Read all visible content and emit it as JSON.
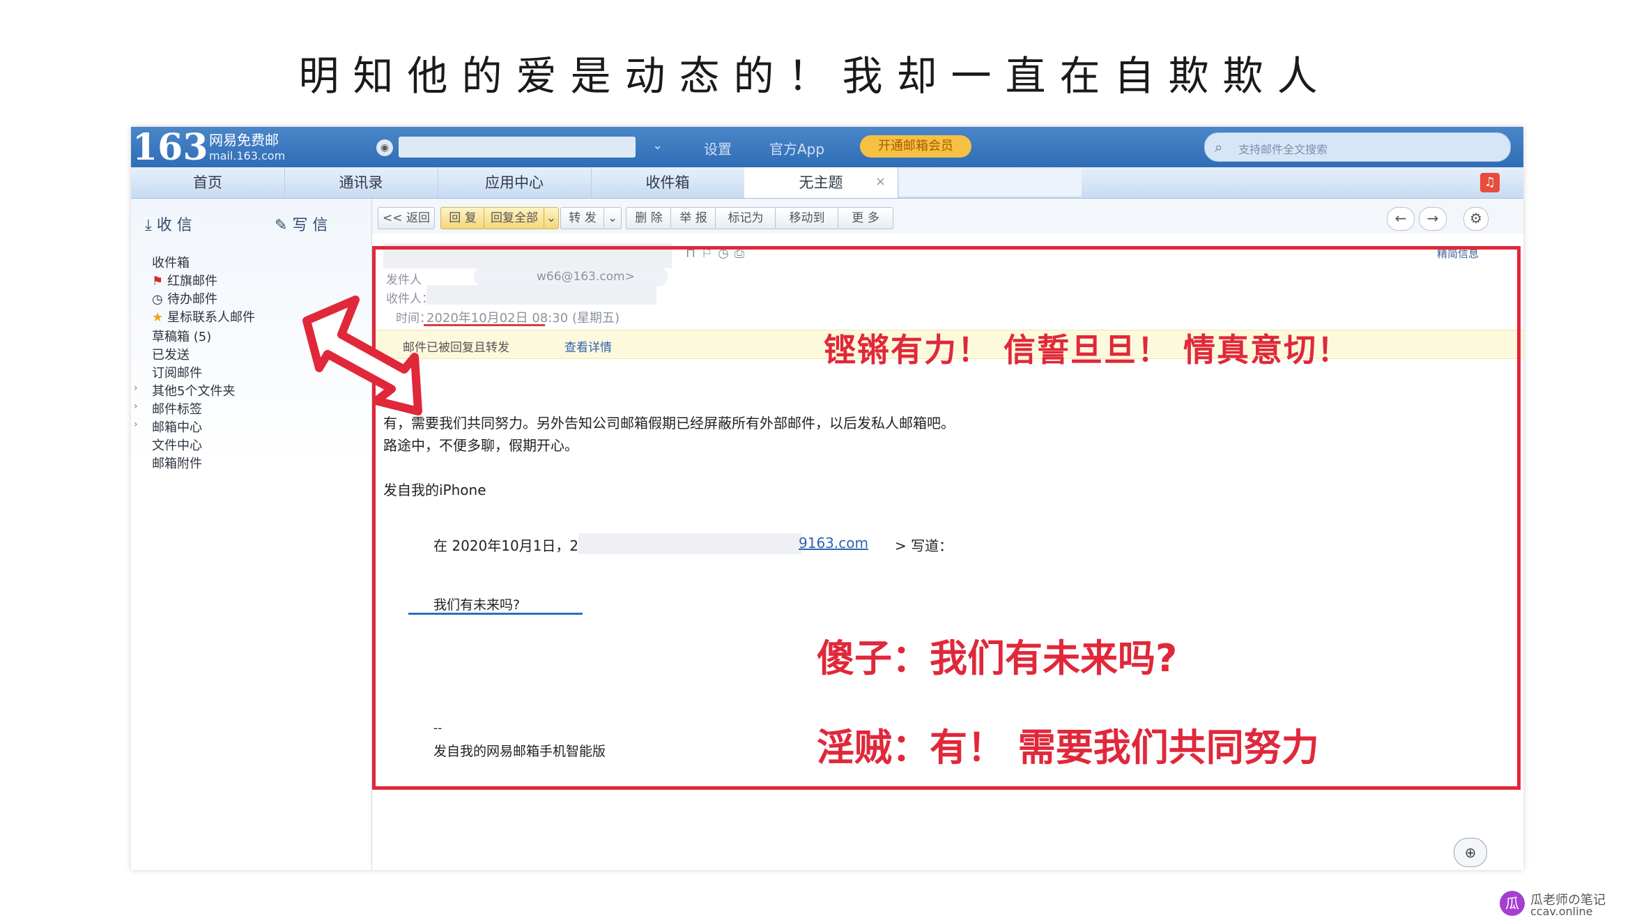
{
  "headline": "明知他的爱是动态的！我却一直在自欺欺人",
  "topbar": {
    "logo": "163",
    "logo_sub": "网易免费邮",
    "logo_url": "mail.163.com",
    "settings": "设置",
    "app": "官方App",
    "vip": "开通邮箱会员",
    "search_placeholder": "支持邮件全文搜索"
  },
  "tabs": [
    "首页",
    "通讯录",
    "应用中心",
    "收件箱",
    "无主题"
  ],
  "sidebar": {
    "receive": "收 信",
    "write": "写 信",
    "items": [
      "收件箱",
      "红旗邮件",
      "待办邮件",
      "星标联系人邮件",
      "草稿箱 (5)",
      "已发送",
      "订阅邮件",
      "其他5个文件夹",
      "邮件标签",
      "邮箱中心",
      "文件中心",
      "邮箱附件"
    ]
  },
  "toolbar": {
    "back": "<< 返回",
    "reply": "回 复",
    "reply_all": "回复全部",
    "forward": "转 发",
    "delete": "删 除",
    "report": "举 报",
    "mark": "标记为",
    "move": "移动到",
    "more": "更 多"
  },
  "mail": {
    "summary": "精简信息",
    "from_label": "发件人",
    "from_addr": "w66@163.com>",
    "to_label": "收件人：",
    "time_label": "时间：",
    "date": "2020年10月02日 08:30",
    "weekday": "(星期五)",
    "notice": "邮件已被回复且转发",
    "notice_link": "查看详情",
    "body_line1": "有，需要我们共同努力。另外告知公司邮箱假期已经屏蔽所有外部邮件，以后发私人邮箱吧。",
    "body_line2": "路途中，不便多聊，假期开心。",
    "body_sig": "发自我的iPhone",
    "quote_prefix": "在 2020年10月1日，21:02,",
    "quote_addr": "9163.com",
    "quote_wrote": "> 写道：",
    "quote_text": "我们有未来吗?",
    "quote_dash": "--",
    "quote_sig": "发自我的网易邮箱手机智能版"
  },
  "annotations": {
    "a1": "铿锵有力！ 信誓旦旦！ 情真意切！",
    "a2": "傻子：我们有未来吗?",
    "a3": "淫贼：有！ 需要我们共同努力"
  },
  "watermark": {
    "line1": "瓜老师の笔记",
    "line2": "ccav.online"
  },
  "colors": {
    "annotation_red": "#e0283a",
    "top_blue": "#2f6db5",
    "link_blue": "#2e63b0"
  }
}
